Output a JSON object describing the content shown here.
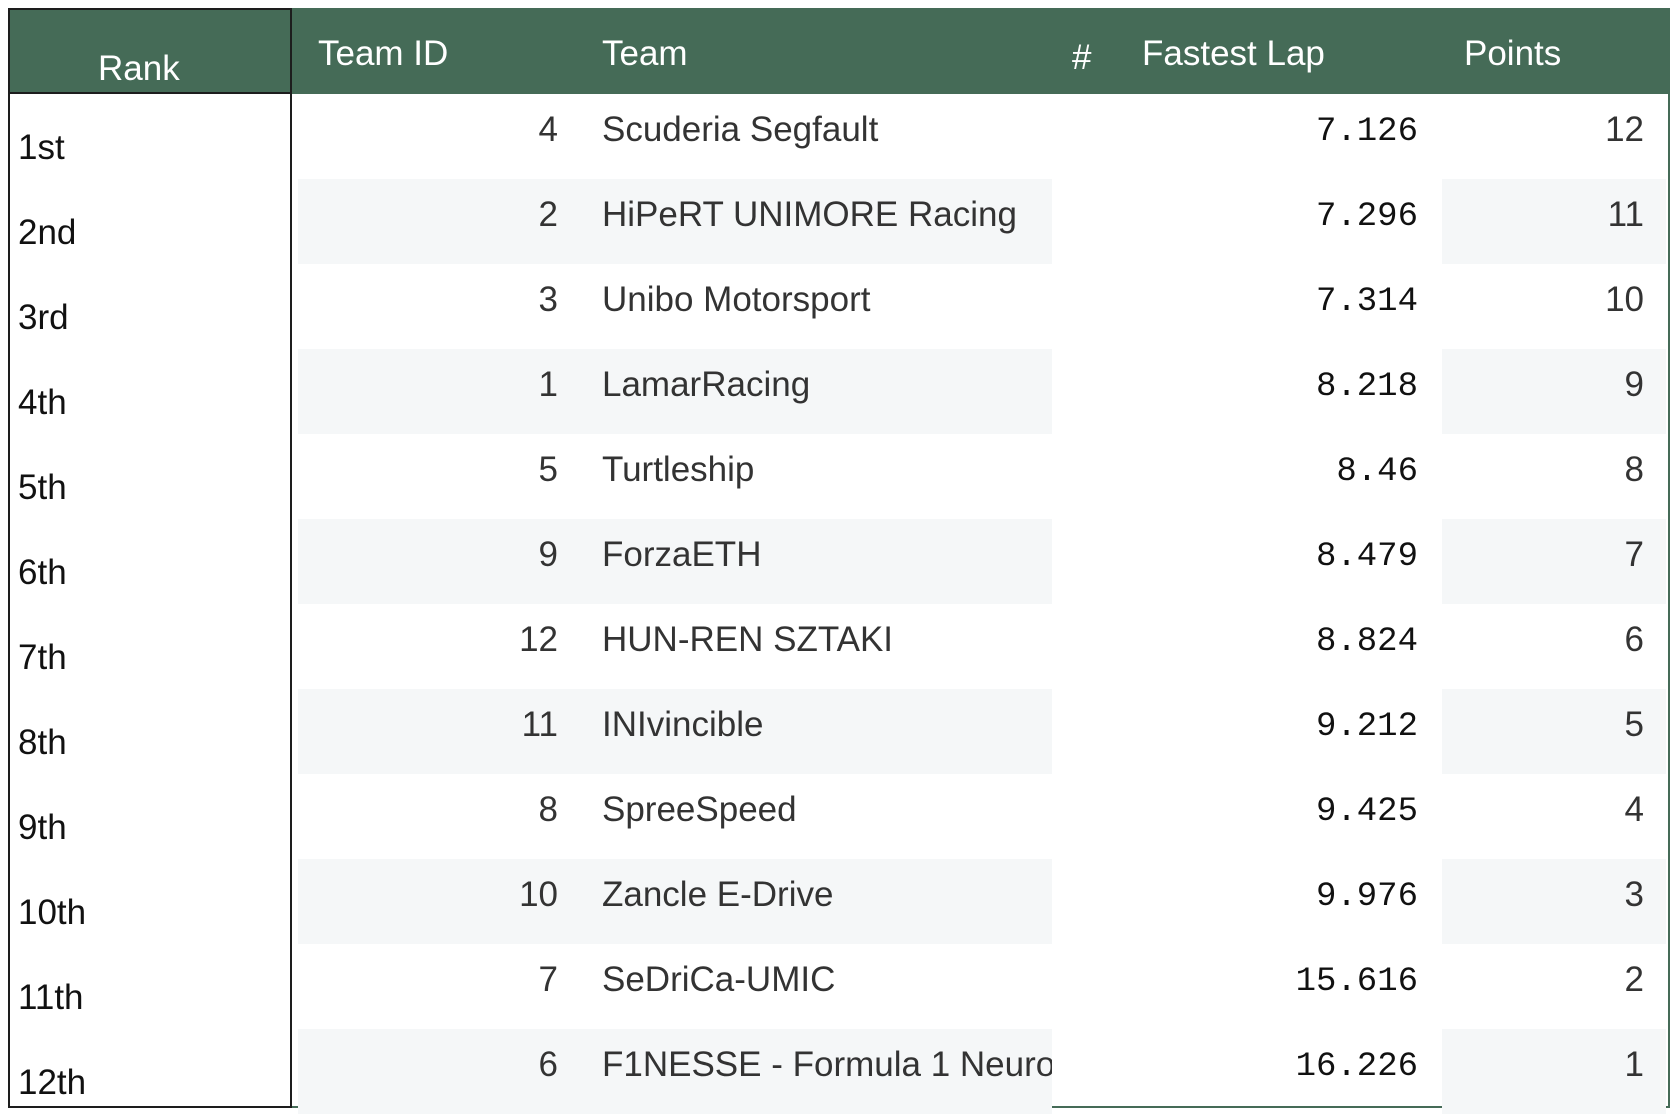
{
  "table": {
    "headers": {
      "rank": "Rank",
      "team_id": "Team ID",
      "team": "Team",
      "hash": "#",
      "fastest_lap": "Fastest Lap",
      "points": "Points"
    },
    "rows": [
      {
        "rank": "1st",
        "team_id": "4",
        "team": "Scuderia Segfault",
        "fastest_lap": "7.126",
        "points": "12"
      },
      {
        "rank": "2nd",
        "team_id": "2",
        "team": "HiPeRT UNIMORE Racing",
        "fastest_lap": "7.296",
        "points": "11"
      },
      {
        "rank": "3rd",
        "team_id": "3",
        "team": "Unibo Motorsport",
        "fastest_lap": "7.314",
        "points": "10"
      },
      {
        "rank": "4th",
        "team_id": "1",
        "team": "LamarRacing",
        "fastest_lap": "8.218",
        "points": "9"
      },
      {
        "rank": "5th",
        "team_id": "5",
        "team": "Turtleship",
        "fastest_lap": "8.46",
        "points": "8"
      },
      {
        "rank": "6th",
        "team_id": "9",
        "team": "ForzaETH",
        "fastest_lap": "8.479",
        "points": "7"
      },
      {
        "rank": "7th",
        "team_id": "12",
        "team": "HUN-REN SZTAKI",
        "fastest_lap": "8.824",
        "points": "6"
      },
      {
        "rank": "8th",
        "team_id": "11",
        "team": "INIvincible",
        "fastest_lap": "9.212",
        "points": "5"
      },
      {
        "rank": "9th",
        "team_id": "8",
        "team": "SpreeSpeed",
        "fastest_lap": "9.425",
        "points": "4"
      },
      {
        "rank": "10th",
        "team_id": "10",
        "team": "Zancle E-Drive",
        "fastest_lap": "9.976",
        "points": "3"
      },
      {
        "rank": "11th",
        "team_id": "7",
        "team": "SeDriCa-UMIC",
        "fastest_lap": "15.616",
        "points": "2"
      },
      {
        "rank": "12th",
        "team_id": "6",
        "team": "F1NESSE - Formula 1 Neuro",
        "fastest_lap": "16.226",
        "points": "1"
      }
    ]
  }
}
